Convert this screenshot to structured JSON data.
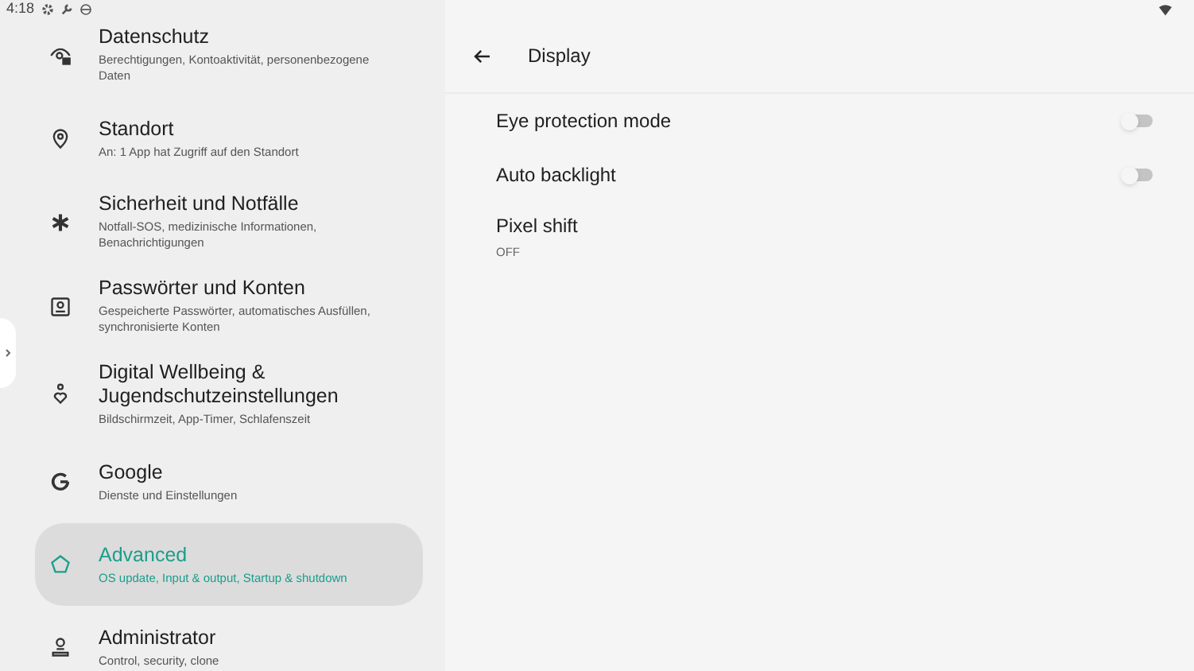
{
  "status_bar": {
    "time": "4:18"
  },
  "sidebar": {
    "items": [
      {
        "kind": "privacy",
        "title": "Datenschutz",
        "subtitle": "Berechtigungen, Kontoaktivität, personenbezogene Daten",
        "selected": false
      },
      {
        "kind": "location",
        "title": "Standort",
        "subtitle": "An: 1 App hat Zugriff auf den Standort",
        "selected": false
      },
      {
        "kind": "asterisk",
        "title": "Sicherheit und Notfälle",
        "subtitle": "Notfall-SOS, medizinische Informationen, Benachrichtigungen",
        "selected": false
      },
      {
        "kind": "accounts",
        "title": "Passwörter und Konten",
        "subtitle": "Gespeicherte Passwörter, automatisches Ausfüllen, synchronisierte Konten",
        "selected": false
      },
      {
        "kind": "wellbeing",
        "title": "Digital Wellbeing & Jugendschutzeinstellungen",
        "subtitle": "Bildschirmzeit, App-Timer, Schlafenszeit",
        "selected": false
      },
      {
        "kind": "google",
        "title": "Google",
        "subtitle": "Dienste und Einstellungen",
        "selected": false
      },
      {
        "kind": "advanced",
        "title": "Advanced",
        "subtitle": "OS update, Input & output, Startup & shutdown",
        "selected": true
      },
      {
        "kind": "admin",
        "title": "Administrator",
        "subtitle": "Control, security, clone",
        "selected": false
      }
    ]
  },
  "detail": {
    "title": "Display",
    "settings": [
      {
        "kind": "switch",
        "label": "Eye protection mode",
        "on": false
      },
      {
        "kind": "switch",
        "label": "Auto backlight",
        "on": false
      },
      {
        "kind": "value",
        "label": "Pixel shift",
        "value": "OFF"
      }
    ]
  }
}
